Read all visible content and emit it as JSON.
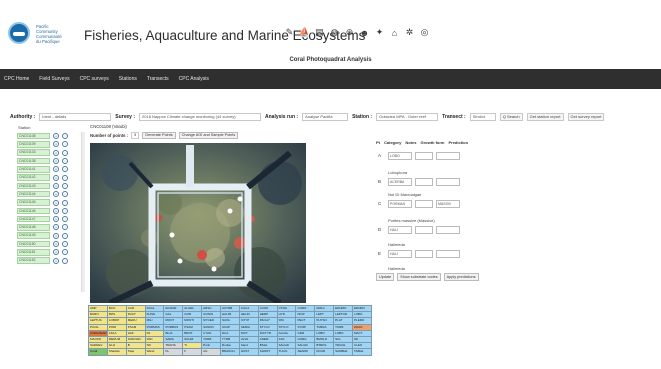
{
  "header": {
    "org_lines": [
      "Pacific",
      "Community",
      "Communauté",
      "du Pacifique"
    ],
    "app_title": "Fisheries, Aquaculture and Marine Ecosystems",
    "icons": [
      "pencil-icon",
      "boat-icon",
      "chart-icon",
      "globe-icon",
      "network-icon",
      "person-icon",
      "fish-icon",
      "home-icon",
      "gear-icon",
      "target-icon"
    ]
  },
  "page_title": "Coral Photoquadrat Analysis",
  "nav": {
    "items": [
      "CPC Home",
      "Field Surveys",
      "CPC surveys",
      "Stations",
      "Transects",
      "CPC Analysis"
    ]
  },
  "filters": {
    "authority_label": "Authority :",
    "authority_value": "Ident - details",
    "survey_label": "Survey :",
    "survey_value": "2018 Nappos Climate change monitoring (44 survey)",
    "analysis_run_label": "Analysis run :",
    "analysis_run_value": "Analyse Pacifia",
    "station_label": "Station :",
    "station_value": "Outsidea MPA - Outer reef",
    "transect_label": "Transect :",
    "transect_value": "Stnd/ct",
    "search_button": "Q Search",
    "get_station_report": "Get station report",
    "get_survey_report": "Get survey report"
  },
  "stations": {
    "label": "Station",
    "items": [
      "CNC01108",
      "CNC01109",
      "CNC01133",
      "CNC01138",
      "CNC01141",
      "CNC01142",
      "CNC01143",
      "CNC01144",
      "CNC01145",
      "CNC01146",
      "CNC01147",
      "CNC01148",
      "CNC01149",
      "CNC01150",
      "CNC01151",
      "CNC01152"
    ]
  },
  "image_panel": {
    "title": "CNC01108 (Vatubi)",
    "points_label": "Number of points :",
    "points_value": "5",
    "generate_points": "Generate Points",
    "change_aoi": "Change AOI and Sample Points"
  },
  "categories": {
    "headers": [
      "Pt",
      "Category",
      "Notes",
      "Growth form",
      "Prediction"
    ],
    "rows": [
      {
        "letter": "A",
        "category": "LOBO",
        "notes": "",
        "growth": "",
        "name": ""
      },
      {
        "letter": "B",
        "category": "ACERBA",
        "notes": "",
        "growth": "",
        "name": "Lobophora"
      },
      {
        "letter": "C",
        "category": "PORMAS",
        "notes": "",
        "growth": "MASSIV",
        "name": "Not ID Macroalgae"
      },
      {
        "letter": "D",
        "category": "HALI",
        "notes": "",
        "growth": "",
        "name": "Porites massive (Massive)"
      },
      {
        "letter": "E",
        "category": "HALI",
        "notes": "",
        "growth": "",
        "name": "Halimeda"
      }
    ],
    "tail_name": "Halimeda",
    "update_button": "Update",
    "show_substrate_button": "Show substrate codes",
    "apply_predictions_button": "Apply predictions"
  },
  "category_table": {
    "rows": [
      [
        [
          "AMP",
          "#f2e48a"
        ],
        [
          "BCO",
          "#f2e48a"
        ],
        [
          "CAR",
          "#f2e48a"
        ],
        [
          "DCAL",
          "#9fd4f5"
        ],
        [
          "EGNOR",
          "#9fd4f5"
        ],
        [
          "ALGRL",
          "#9fd4f5"
        ],
        [
          "ARSC",
          "#9fd4f5"
        ],
        [
          "AUTRB",
          "#9fd4f5"
        ],
        [
          "CACA",
          "#9fd4f5"
        ],
        [
          "CCNK",
          "#9fd4f5"
        ],
        [
          "CTRG",
          "#9fd4f5"
        ],
        [
          "CORN",
          "#9fd4f5"
        ],
        [
          "DMLC",
          "#9fd4f5"
        ],
        [
          "EDNMO",
          "#9fd4f5"
        ],
        [
          "EDNRO",
          "#9fd4f5"
        ]
      ],
      [
        [
          "BURN",
          "#f2e48a"
        ],
        [
          "BWL",
          "#f2e48a"
        ],
        [
          "DACT",
          "#f2e48a"
        ],
        [
          "FUNG",
          "#9fd4f5"
        ],
        [
          "GAL",
          "#9fd4f5"
        ],
        [
          "GOR",
          "#9fd4f5"
        ],
        [
          "GONIO",
          "#9fd4f5"
        ],
        [
          "HALIM",
          "#9fd4f5"
        ],
        [
          "HELIO",
          "#9fd4f5"
        ],
        [
          "HERP",
          "#9fd4f5"
        ],
        [
          "HYD",
          "#9fd4f5"
        ],
        [
          "ISOP",
          "#9fd4f5"
        ],
        [
          "LEPT",
          "#9fd4f5"
        ],
        [
          "LEPTOR",
          "#9fd4f5"
        ],
        [
          "LOBO",
          "#9fd4f5"
        ]
      ],
      [
        [
          "LEPTUS",
          "#f2e48a"
        ],
        [
          "LOBOP",
          "#f2e48a"
        ],
        [
          "MERU",
          "#f2e48a"
        ],
        [
          "MILI",
          "#9fd4f5"
        ],
        [
          "MONT",
          "#9fd4f5"
        ],
        [
          "MONTI",
          "#9fd4f5"
        ],
        [
          "MYCED",
          "#9fd4f5"
        ],
        [
          "NAVA",
          "#9fd4f5"
        ],
        [
          "OXYP",
          "#9fd4f5"
        ],
        [
          "PACHY",
          "#9fd4f5"
        ],
        [
          "PAV",
          "#9fd4f5"
        ],
        [
          "PECT",
          "#9fd4f5"
        ],
        [
          "PHYSO",
          "#9fd4f5"
        ],
        [
          "PLAT",
          "#9fd4f5"
        ],
        [
          "PLERO",
          "#9fd4f5"
        ]
      ],
      [
        [
          "POCIL",
          "#f2e48a"
        ],
        [
          "PORI",
          "#f2e48a"
        ],
        [
          "PSAM",
          "#f2e48a"
        ],
        [
          "PORMAS",
          "#9fd4f5"
        ],
        [
          "PORBUS",
          "#9fd4f5"
        ],
        [
          "PSAM",
          "#9fd4f5"
        ],
        [
          "SANDO",
          "#9fd4f5"
        ],
        [
          "SCAP",
          "#9fd4f5"
        ],
        [
          "SERIA",
          "#9fd4f5"
        ],
        [
          "STYLO",
          "#9fd4f5"
        ],
        [
          "STYLO",
          "#9fd4f5"
        ],
        [
          "SYMP",
          "#9fd4f5"
        ],
        [
          "TUBRA",
          "#9fd4f5"
        ],
        [
          "TURB",
          "#9fd4f5"
        ],
        [
          "ZOAN",
          "#f0a06a"
        ]
      ],
      [
        [
          "CORLDEAD",
          "#e07840"
        ],
        [
          "FDLA",
          "#f2e48a"
        ],
        [
          "HAF",
          "#f2e48a"
        ],
        [
          "R1",
          "#f2e48a"
        ],
        [
          "Bnub",
          "#9fd4f5"
        ],
        [
          "BROT",
          "#9fd4f5"
        ],
        [
          "CYAN",
          "#9fd4f5"
        ],
        [
          "DCA",
          "#9fd4f5"
        ],
        [
          "DICT",
          "#9fd4f5"
        ],
        [
          "DICTYR",
          "#9fd4f5"
        ],
        [
          "ALGAL",
          "#9fd4f5"
        ],
        [
          "GRR",
          "#9fd4f5"
        ],
        [
          "LOBO",
          "#9fd4f5"
        ],
        [
          "LOBO",
          "#9fd4f5"
        ],
        [
          "MACT",
          "#9fd4f5"
        ]
      ],
      [
        [
          "MACRO",
          "#f2e48a"
        ],
        [
          "MERUM",
          "#f2e48a"
        ],
        [
          "SODOAD",
          "#f2e48a"
        ],
        [
          "PAD",
          "#f2e48a"
        ],
        [
          "SARG",
          "#9fd4f5"
        ],
        [
          "SCHIZ",
          "#9fd4f5"
        ],
        [
          "TURB",
          "#9fd4f5"
        ],
        [
          "TYDB",
          "#9fd4f5"
        ],
        [
          "ULVA",
          "#9fd4f5"
        ],
        [
          "ANEM",
          "#9fd4f5"
        ],
        [
          "ASC",
          "#9fd4f5"
        ],
        [
          "GORG",
          "#9fd4f5"
        ],
        [
          "BMOLD",
          "#9fd4f5"
        ],
        [
          "SCL",
          "#9fd4f5"
        ],
        [
          "SD",
          "#9fd4f5"
        ]
      ],
      [
        [
          "SADDEV",
          "#f2e48a"
        ],
        [
          "GLO",
          "#f2e48a"
        ],
        [
          "B",
          "#f2e48a"
        ],
        [
          "SD",
          "#f2e48a"
        ],
        [
          "TRANS",
          "#d8d8d8"
        ],
        [
          "TI",
          "#f2e48a"
        ],
        [
          "Purin",
          "#9fd4f5"
        ],
        [
          "Rudsa",
          "#9fd4f5"
        ],
        [
          "Sand",
          "#9fd4f5"
        ],
        [
          "BSHL",
          "#9fd4f5"
        ],
        [
          "SALGR",
          "#9fd4f5"
        ],
        [
          "SALGR",
          "#9fd4f5"
        ],
        [
          "BTRKS",
          "#9fd4f5"
        ],
        [
          "TRACE",
          "#9fd4f5"
        ],
        [
          "CLEO",
          "#9fd4f5"
        ]
      ],
      [
        [
          "Coral",
          "#7fc36a"
        ],
        [
          "Shadow",
          "#f2e48a"
        ],
        [
          "Tape",
          "#f2e48a"
        ],
        [
          "Wand",
          "#f2e48a"
        ],
        [
          "KL",
          "#d8d8d8"
        ],
        [
          "F",
          "#d8d8d8"
        ],
        [
          "AG",
          "#d8d8d8"
        ],
        [
          "BRANCH",
          "#9fd4f5"
        ],
        [
          "HOST",
          "#9fd4f5"
        ],
        [
          "SHORT",
          "#9fd4f5"
        ],
        [
          "TULIG",
          "#9fd4f5"
        ],
        [
          "SEARD",
          "#9fd4f5"
        ],
        [
          "DOUR",
          "#9fd4f5"
        ],
        [
          "SAMBLE",
          "#9fd4f5"
        ],
        [
          "TABLE",
          "#9fd4f5"
        ]
      ]
    ]
  }
}
